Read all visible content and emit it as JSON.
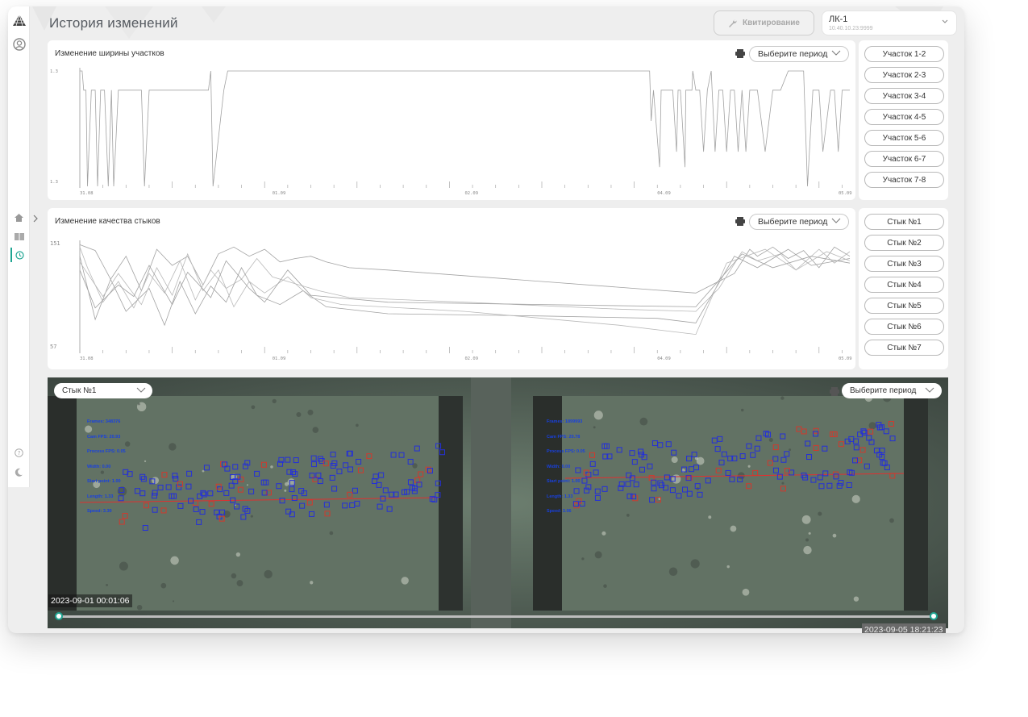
{
  "header": {
    "title": "История изменений",
    "ack_label": "Квитирование",
    "line_name": "ЛК-1",
    "line_ip": "10.40.10.23:9999"
  },
  "width_panel": {
    "title": "Изменение ширины участков",
    "period_label": "Выберите период",
    "sections": [
      "Участок 1-2",
      "Участок 2-3",
      "Участок 3-4",
      "Участок 4-5",
      "Участок 5-6",
      "Участок 6-7",
      "Участок 7-8"
    ]
  },
  "quality_panel": {
    "title": "Изменение качества стыков",
    "period_label": "Выберите период",
    "joints": [
      "Стык №1",
      "Стык №2",
      "Стык №3",
      "Стык №4",
      "Стык №5",
      "Стык №6",
      "Стык №7"
    ]
  },
  "chart_data": [
    {
      "type": "line",
      "x_tick_labels": [
        "31.08",
        "01.09",
        "02.09",
        "04.09",
        "05.09"
      ],
      "y_tick_labels": [
        "1.3",
        "1.3"
      ],
      "grid": false,
      "series": [
        {
          "x": [
            0,
            0.3,
            0.5,
            0.8,
            1,
            1.5,
            1.7,
            2,
            2.3,
            2.7,
            3.2,
            3.7,
            4.1,
            4.4,
            5,
            6,
            7,
            8,
            8.4,
            9,
            9.5,
            10,
            10.5,
            11,
            12,
            13,
            14,
            15,
            16.7,
            17,
            17.3,
            18.7,
            19.2,
            20,
            30,
            40,
            50,
            60,
            70,
            71,
            72.5,
            74,
            74.2,
            74.5,
            75.3,
            75.5,
            77,
            77.5,
            77.7,
            78,
            78.6,
            78.7,
            79.5,
            79.6,
            80,
            80.5,
            81,
            81.5,
            82,
            82.5,
            83,
            83.5,
            84,
            84.5,
            85,
            85.5,
            86,
            86.5,
            87,
            87.3,
            88,
            89,
            90,
            91,
            92,
            93.5,
            94,
            94.5,
            95.2,
            96,
            96.5,
            97.5,
            98,
            98.5,
            99,
            100
          ],
          "y": [
            1.3033,
            1.3033,
            1.3028,
            1.3028,
            1.3003,
            1.3028,
            1.3028,
            1.3028,
            1.3003,
            1.3028,
            1.3028,
            1.3003,
            1.3028,
            1.3003,
            1.3028,
            1.3028,
            1.3028,
            1.3028,
            1.3003,
            1.3028,
            1.3028,
            1.3028,
            1.3028,
            1.3028,
            1.3028,
            1.3028,
            1.3028,
            1.3028,
            1.3028,
            1.3033,
            1.3003,
            1.3028,
            1.3033,
            1.3033,
            1.3033,
            1.3033,
            1.3033,
            1.3033,
            1.3033,
            1.3033,
            1.3033,
            1.3033,
            1.302,
            1.3028,
            1.3008,
            1.3028,
            1.3028,
            1.3012,
            1.3028,
            1.3028,
            1.3008,
            1.3028,
            1.3028,
            1.3033,
            1.3028,
            1.3028,
            1.3012,
            1.3028,
            1.3033,
            1.3012,
            1.3028,
            1.3028,
            1.3012,
            1.3028,
            1.3028,
            1.3012,
            1.3028,
            1.3012,
            1.3028,
            1.3028,
            1.3028,
            1.3012,
            1.3028,
            1.3028,
            1.3033,
            1.3033,
            1.3033,
            1.3003,
            1.3028,
            1.3028,
            1.3012,
            1.3028,
            1.3028,
            1.3012,
            1.3028,
            1.3028
          ]
        }
      ]
    },
    {
      "type": "line",
      "x_tick_labels": [
        "31.08",
        "01.09",
        "02.09",
        "04.09",
        "05.09"
      ],
      "y_tick_labels": [
        "151",
        "57"
      ],
      "ylim": [
        57,
        151
      ],
      "grid": false,
      "series": [
        {
          "x": [
            0,
            2,
            4,
            6,
            8,
            10,
            12,
            14,
            16,
            18,
            20,
            22,
            24,
            26,
            28,
            30,
            32,
            35,
            40,
            60,
            80,
            85,
            87,
            88,
            90,
            92,
            94,
            96,
            98,
            100
          ],
          "y": [
            150,
            145,
            120,
            140,
            110,
            146,
            132,
            140,
            115,
            142,
            148,
            140,
            146,
            135,
            138,
            140,
            135,
            130,
            128,
            118,
            108,
            125,
            146,
            140,
            148,
            138,
            145,
            130,
            148,
            140
          ]
        },
        {
          "x": [
            0,
            1,
            3,
            5,
            7,
            9,
            11,
            13,
            15,
            17,
            19,
            21,
            23,
            25,
            28,
            31,
            35,
            50,
            70,
            80,
            83,
            86,
            88,
            91,
            93,
            96,
            98,
            100
          ],
          "y": [
            148,
            130,
            100,
            118,
            95,
            125,
            108,
            136,
            102,
            128,
            112,
            120,
            138,
            122,
            116,
            110,
            104,
            100,
            94,
            92,
            112,
            144,
            136,
            142,
            128,
            146,
            134,
            144
          ]
        },
        {
          "x": [
            0,
            2,
            4,
            6,
            9,
            11,
            13,
            15,
            17,
            19,
            21,
            23,
            26,
            29,
            32,
            40,
            60,
            75,
            80,
            85,
            88,
            92,
            95,
            100
          ],
          "y": [
            140,
            85,
            120,
            92,
            112,
            80,
            118,
            90,
            114,
            100,
            130,
            106,
            98,
            110,
            96,
            90,
            88,
            86,
            82,
            140,
            130,
            146,
            132,
            138
          ]
        },
        {
          "x": [
            0,
            3,
            5,
            8,
            10,
            12,
            14,
            16,
            18,
            20,
            22,
            24,
            27,
            30,
            34,
            50,
            70,
            80,
            84,
            89,
            93,
            97,
            100
          ],
          "y": [
            135,
            105,
            125,
            98,
            130,
            106,
            142,
            110,
            128,
            96,
            118,
            108,
            122,
            104,
            98,
            92,
            80,
            72,
            134,
            146,
            128,
            144,
            136
          ]
        },
        {
          "x": [
            0,
            2,
            5,
            7,
            9,
            12,
            14,
            17,
            19,
            22,
            24,
            27,
            30,
            40,
            60,
            80,
            86,
            90,
            95,
            100
          ],
          "y": [
            128,
            95,
            115,
            105,
            132,
            98,
            126,
            104,
            136,
            112,
            100,
            128,
            106,
            100,
            98,
            96,
            142,
            130,
            140,
            134
          ]
        }
      ]
    }
  ],
  "video": {
    "joint_select": "Стык №1",
    "period_label": "Выберите период",
    "time_start": "2023-09-01 00:01:06",
    "time_end": "2023-09-05 18:21:23",
    "cam1_hud": [
      "Frames: 348376",
      "Cam FPS: 20.93",
      "Process FPS: 0.05",
      "Width: 0.00",
      "Start point: 1.00",
      "Length: 1.33",
      "Speed: 3.30"
    ],
    "cam2_hud": [
      "Frames: 1899993",
      "Cam FPS: 20.78",
      "Process FPS: 0.05",
      "Width: 0.00",
      "Start point: 1.00",
      "Length: 1.33",
      "Speed: 3.06"
    ]
  },
  "colors": {
    "accent": "#1fa592",
    "chart_line": "#a9a9a9",
    "detect_blue": "#2430d8",
    "detect_red": "#d03a2e"
  },
  "icons": [
    "logo-triangle-icon",
    "user-icon",
    "home-icon",
    "book-icon",
    "history-icon",
    "help-icon",
    "moon-icon",
    "wrench-icon",
    "printer-icon",
    "chevron-down-icon",
    "chevron-right-icon"
  ]
}
